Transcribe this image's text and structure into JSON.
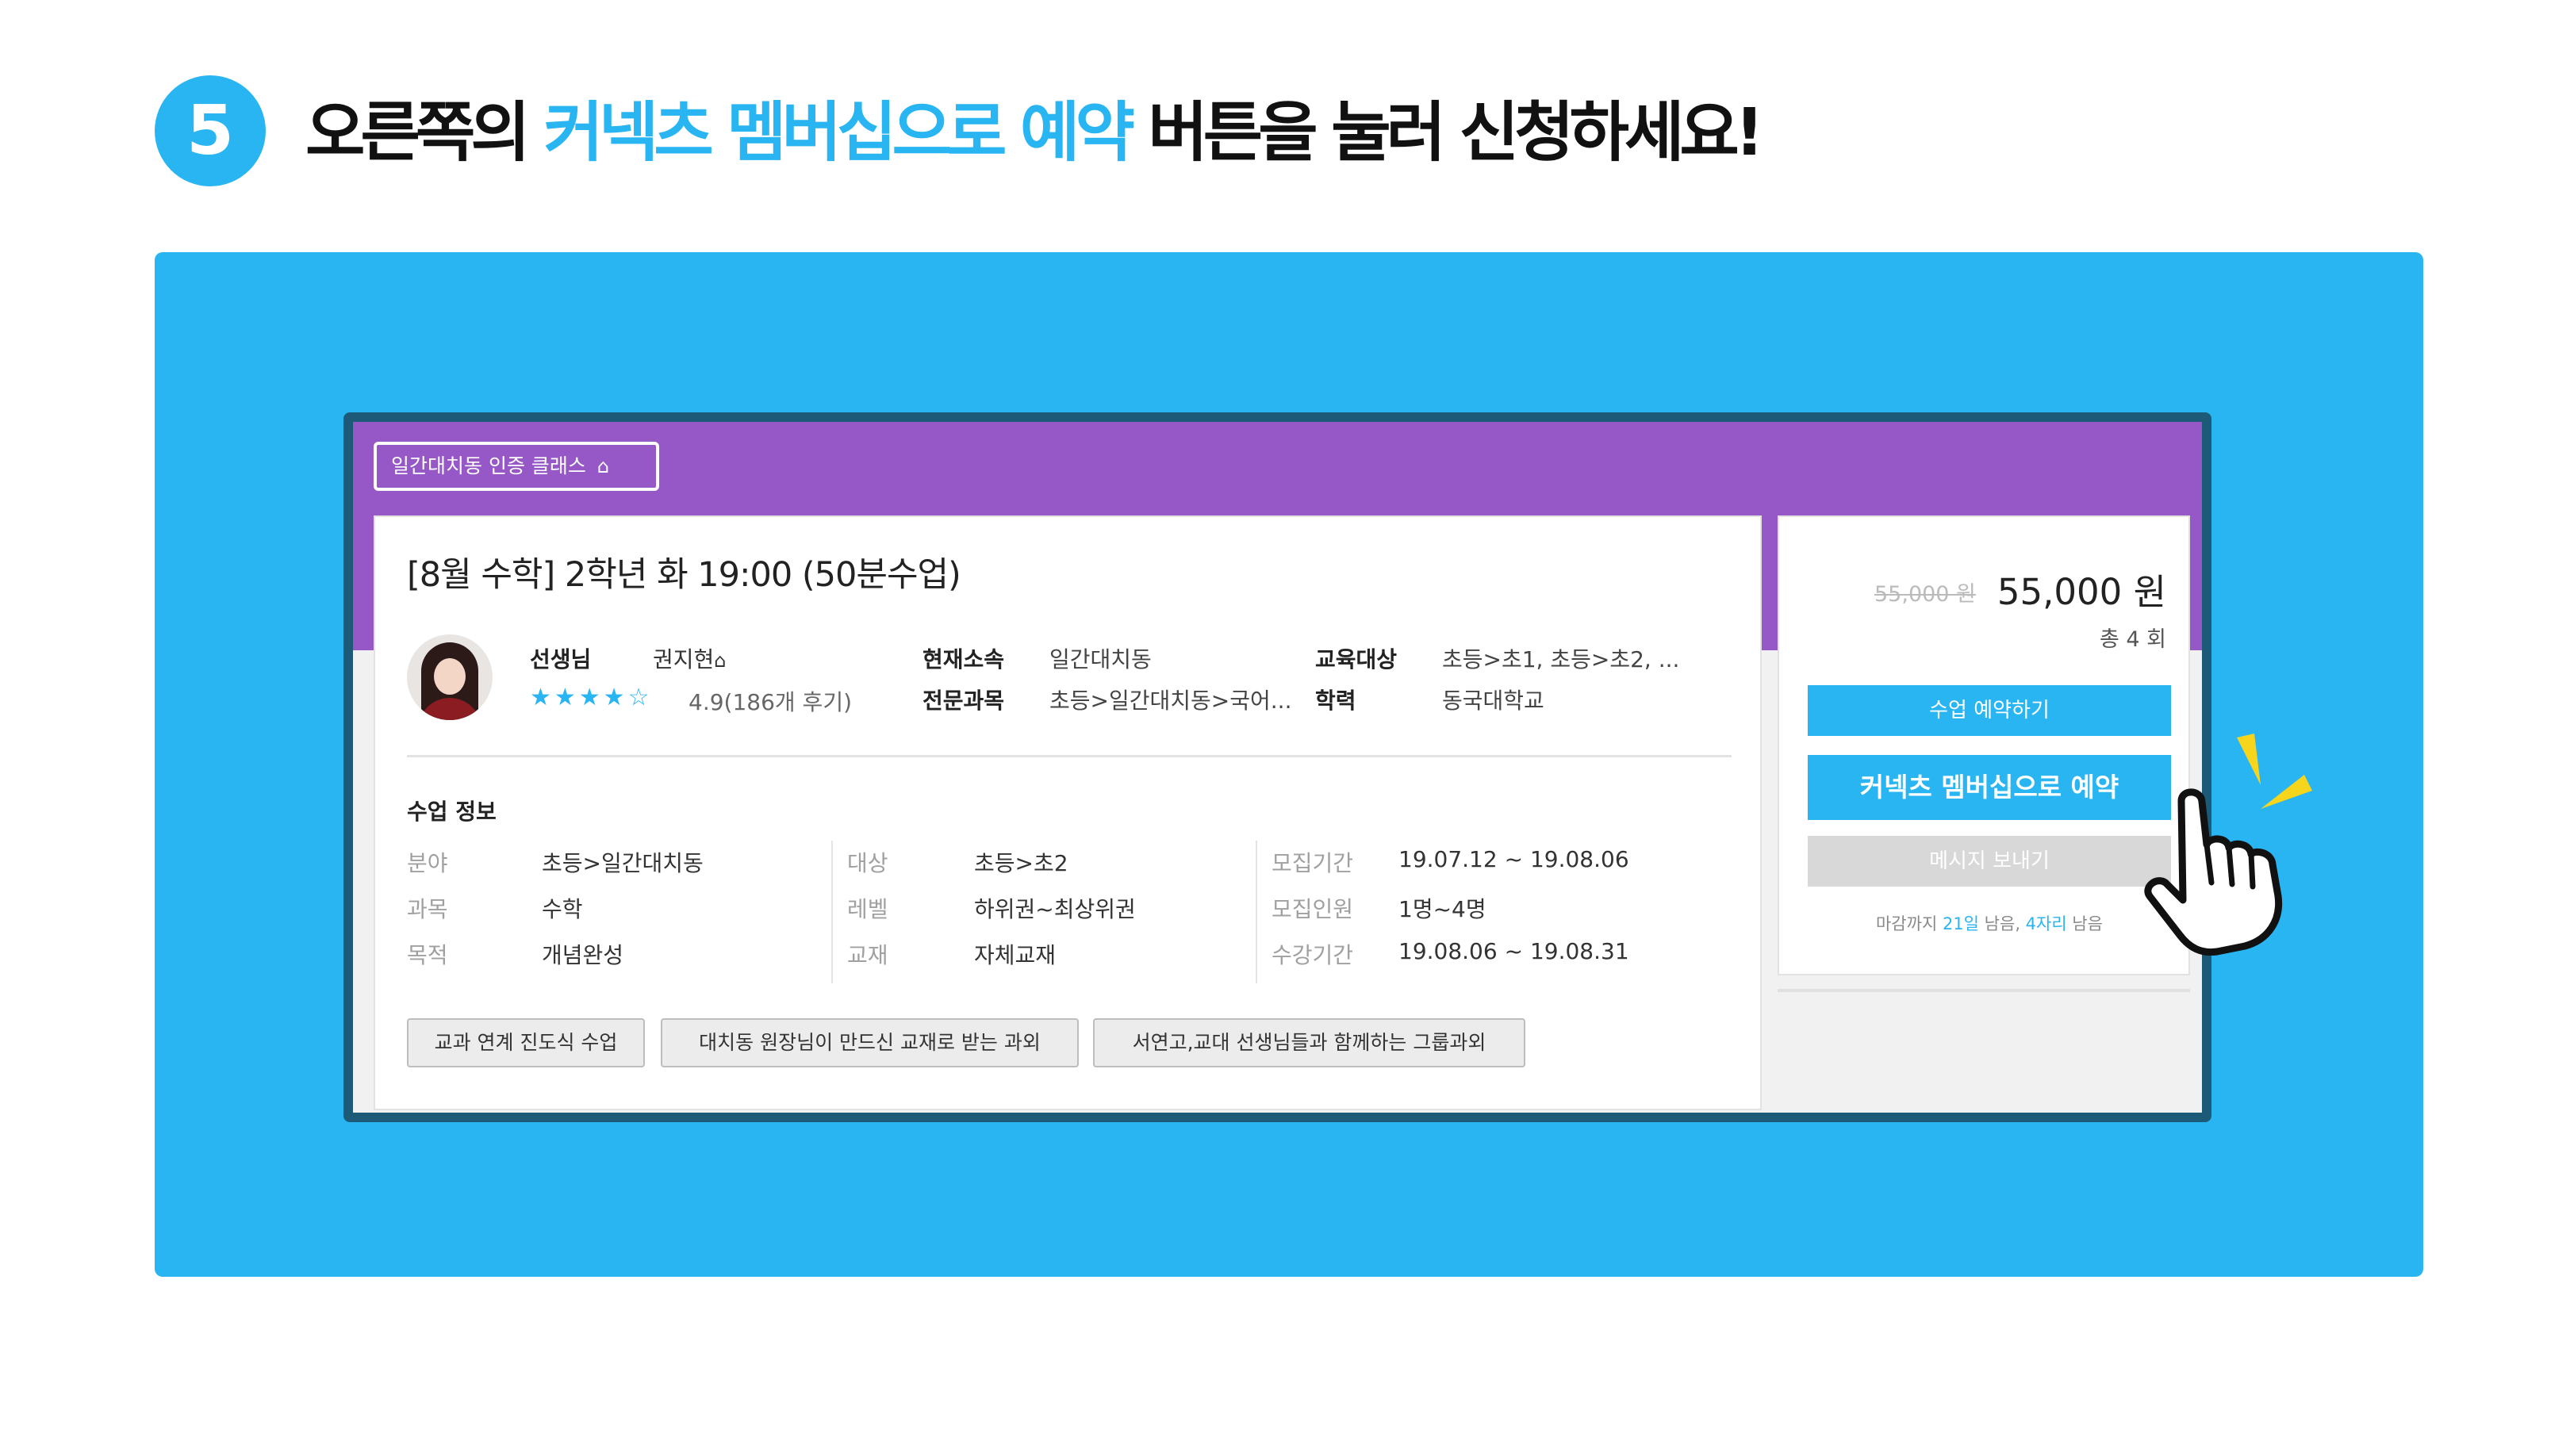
{
  "step": {
    "number": "5"
  },
  "headline": {
    "part1": "오른쪽의 ",
    "highlight": "커넥츠 멤버십으로 예약",
    "part2": " 버튼을 눌러 신청하세요!"
  },
  "colors": {
    "accent": "#29b5f2",
    "purple": "#9558c6",
    "frame": "#1c5a78"
  },
  "page": {
    "cert_badge": "일간대치동 인증 클래스",
    "cert_icon": "home-icon",
    "class_title": "[8월 수학] 2학년 화 19:00 (50분수업)",
    "teacher": {
      "label": "선생님",
      "name": "권지현",
      "name_icon": "home-icon",
      "stars": "★★★★☆",
      "star_value": 4.5,
      "rating": "4.9(186개 후기)"
    },
    "profile": {
      "affiliation_label": "현재소속",
      "affiliation": "일간대치동",
      "subject_label": "전문과목",
      "subject": "초등>일간대치동>국어...",
      "target_label": "교육대상",
      "target": "초등>초1, 초등>초2, ...",
      "education_label": "학력",
      "education": "동국대학교"
    },
    "class_info": {
      "title": "수업 정보",
      "col1": [
        {
          "k": "분야",
          "v": "초등>일간대치동"
        },
        {
          "k": "과목",
          "v": "수학"
        },
        {
          "k": "목적",
          "v": "개념완성"
        }
      ],
      "col2": [
        {
          "k": "대상",
          "v": "초등>초2"
        },
        {
          "k": "레벨",
          "v": "하위권~최상위권"
        },
        {
          "k": "교재",
          "v": "자체교재"
        }
      ],
      "col3": [
        {
          "k": "모집기간",
          "v": "19.07.12 ~ 19.08.06"
        },
        {
          "k": "모집인원",
          "v": "1명~4명"
        },
        {
          "k": "수강기간",
          "v": "19.08.06 ~ 19.08.31"
        }
      ]
    },
    "tags": [
      "교과 연계 진도식 수업",
      "대치동 원장님이 만드신 교재로 받는 과외",
      "서연고,교대 선생님들과 함께하는 그룹과외"
    ],
    "sidebar": {
      "old_price": "55,000 원",
      "price": "55,000 원",
      "sessions": "총 4 회",
      "reserve_button": "수업 예약하기",
      "membership_button": "커넥츠 멤버십으로 예약",
      "message_button": "메시지 보내기",
      "deadline_pre": "마감까지 ",
      "deadline_days": "21일",
      "deadline_mid": " 남음, ",
      "deadline_seats": "4자리",
      "deadline_post": " 남음"
    }
  }
}
